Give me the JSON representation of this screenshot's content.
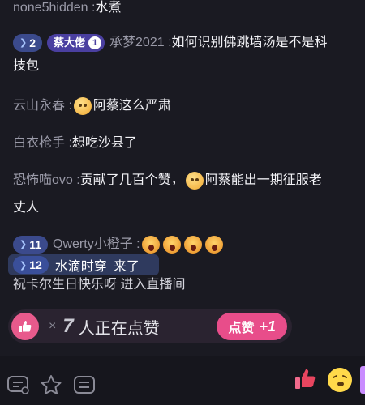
{
  "chat": {
    "m1": {
      "user": "none5hidden",
      "colon": ":",
      "text": "水煮"
    },
    "m2": {
      "level": "2",
      "fan_badge": "蔡大佬",
      "fan_level": "1",
      "user": "承梦2021",
      "colon": ":",
      "text_line1": "如何识别佛跳墙汤是不是科",
      "text_line2": "技包"
    },
    "m3": {
      "user": "云山永春",
      "colon": ":",
      "text": "阿蔡这么严肃"
    },
    "m4": {
      "user": "白衣枪手",
      "colon": ":",
      "text": "想吃沙县了"
    },
    "m5": {
      "user": "恐怖喵ovo",
      "colon": ":",
      "text_a": "贡献了几百个赞，",
      "text_b": "阿蔡能出一期征服老",
      "text_line2": "丈人"
    },
    "m6": {
      "level": "11",
      "user": "Qwerty小橙子",
      "colon": ":"
    },
    "m7": {
      "level": "12",
      "user": "水滴时穿",
      "text": "来了"
    },
    "m8": {
      "text": "祝卡尔生日快乐呀 进入直播间"
    }
  },
  "like_bar": {
    "x": "×",
    "count": "7",
    "text": "人正在点赞",
    "button_label": "点赞",
    "button_plus": "+1"
  },
  "colors": {
    "background": "#1a1a22",
    "accent_pink": "#e84d8a",
    "badge_blue": "#3b4a8c",
    "badge_purple": "#4a3fa0"
  },
  "icons": [
    "thumbs-up-icon",
    "chat-bubble-icon",
    "star-icon",
    "list-icon",
    "like-gift-icon",
    "emoji-face-icon"
  ]
}
